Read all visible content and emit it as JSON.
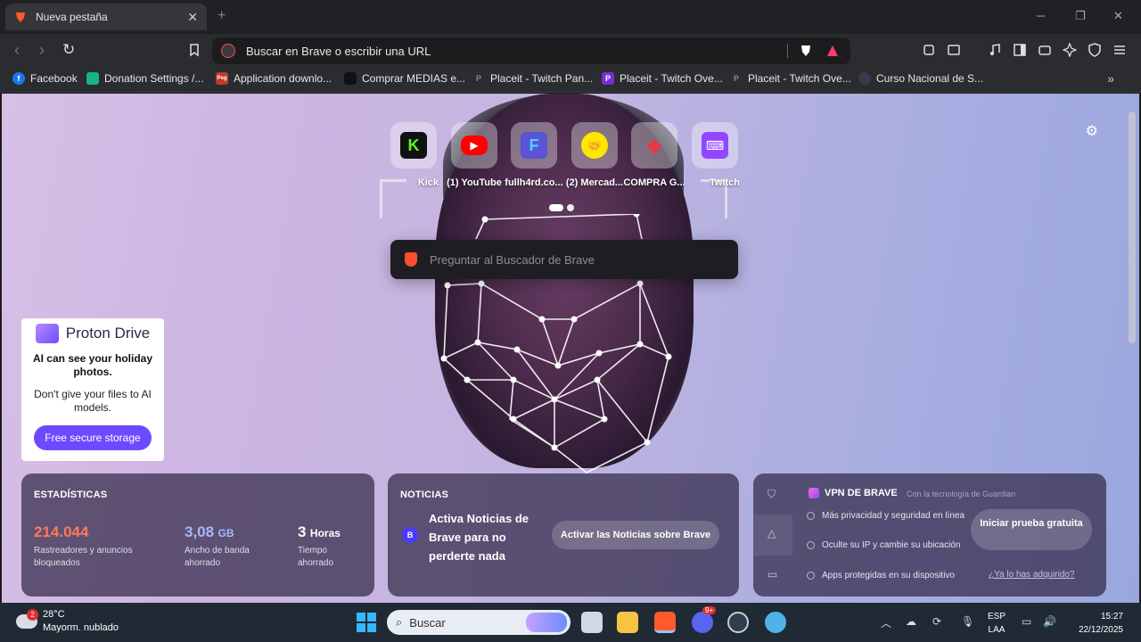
{
  "tab": {
    "title": "Nueva pestaña",
    "close": "✕"
  },
  "window": {
    "new_tab": "+",
    "minimize": "─",
    "restore": "❐",
    "close": "✕"
  },
  "toolbar": {
    "url_placeholder": "Buscar en Brave o escribir una URL"
  },
  "bookmarks": [
    {
      "label": "Facebook",
      "color": "#1877f2",
      "glyph": "f"
    },
    {
      "label": "Donation Settings /...",
      "color": "#18b38b",
      "glyph": ""
    },
    {
      "label": "Application downlo...",
      "color": "#c0392b",
      "glyph": "Peg"
    },
    {
      "label": "Comprar MEDIAS e...",
      "color": "#111111",
      "glyph": ""
    },
    {
      "label": "Placeit - Twitch Pan...",
      "color": "#3a3a3e",
      "glyph": "P"
    },
    {
      "label": "Placeit - Twitch Ove...",
      "color": "#7a2dd8",
      "glyph": "P"
    },
    {
      "label": "Placeit - Twitch Ove...",
      "color": "#3a3a3e",
      "glyph": "P"
    },
    {
      "label": "Curso Nacional de S...",
      "color": "#3a3a4e",
      "glyph": ""
    }
  ],
  "top_sites": [
    {
      "label": "Kick",
      "bg": "#111111",
      "fg": "#53fc18",
      "glyph": "K"
    },
    {
      "label": "(1) YouTube",
      "bg": "#ff0000",
      "fg": "#ffffff",
      "glyph": "▶"
    },
    {
      "label": "fullh4rd.co...",
      "bg": "#5a55d6",
      "fg": "#4dd0ff",
      "glyph": "F"
    },
    {
      "label": "(2) Mercad...",
      "bg": "#ffe600",
      "fg": "#2d3277",
      "glyph": "🤝"
    },
    {
      "label": "COMPRA G...",
      "bg": "#dcdce2",
      "fg": "#e63946",
      "glyph": "◆"
    },
    {
      "label": "Twitch",
      "bg": "#9146ff",
      "fg": "#ffffff",
      "glyph": "⌨"
    }
  ],
  "search": {
    "placeholder": "Preguntar al Buscador de Brave"
  },
  "ad": {
    "brand": "Proton Drive",
    "headline": "AI can see your holiday photos.",
    "body": "Don't give your files to AI models.",
    "cta": "Free secure storage"
  },
  "stats": {
    "title": "ESTADÍSTICAS",
    "trackers": {
      "value": "214.044",
      "label": "Rastreadores y anuncios bloqueados",
      "color": "#ff7a59"
    },
    "bandwidth": {
      "value": "3,08",
      "unit": "GB",
      "label": "Ancho de banda ahorrado",
      "color": "#a7b8ff"
    },
    "time": {
      "value": "3",
      "unit": "Horas",
      "label": "Tiempo ahorrado",
      "color": "#ffffff"
    }
  },
  "news": {
    "title": "NOTICIAS",
    "badge": "B",
    "text": "Activa Noticias de Brave para no perderte nada",
    "cta": "Activar las Noticias sobre Brave"
  },
  "vpn": {
    "title": "VPN DE BRAVE",
    "powered_by": "Con la tecnología de  Guardian",
    "features": [
      "Más privacidad y seguridad en línea",
      "Oculte su IP y cambie su ubicación",
      "Apps protegidas en su dispositivo"
    ],
    "cta": "Iniciar prueba gratuita",
    "link": "¿Ya lo has adquirido?"
  },
  "taskbar": {
    "weather_badge": "2",
    "temperature": "28°C",
    "condition": "Mayorm. nublado",
    "search_placeholder": "Buscar",
    "lang_top": "ESP",
    "lang_bottom": "LAA",
    "time": "15:27",
    "date": "22/12/2025",
    "discord_badge": "9+"
  }
}
